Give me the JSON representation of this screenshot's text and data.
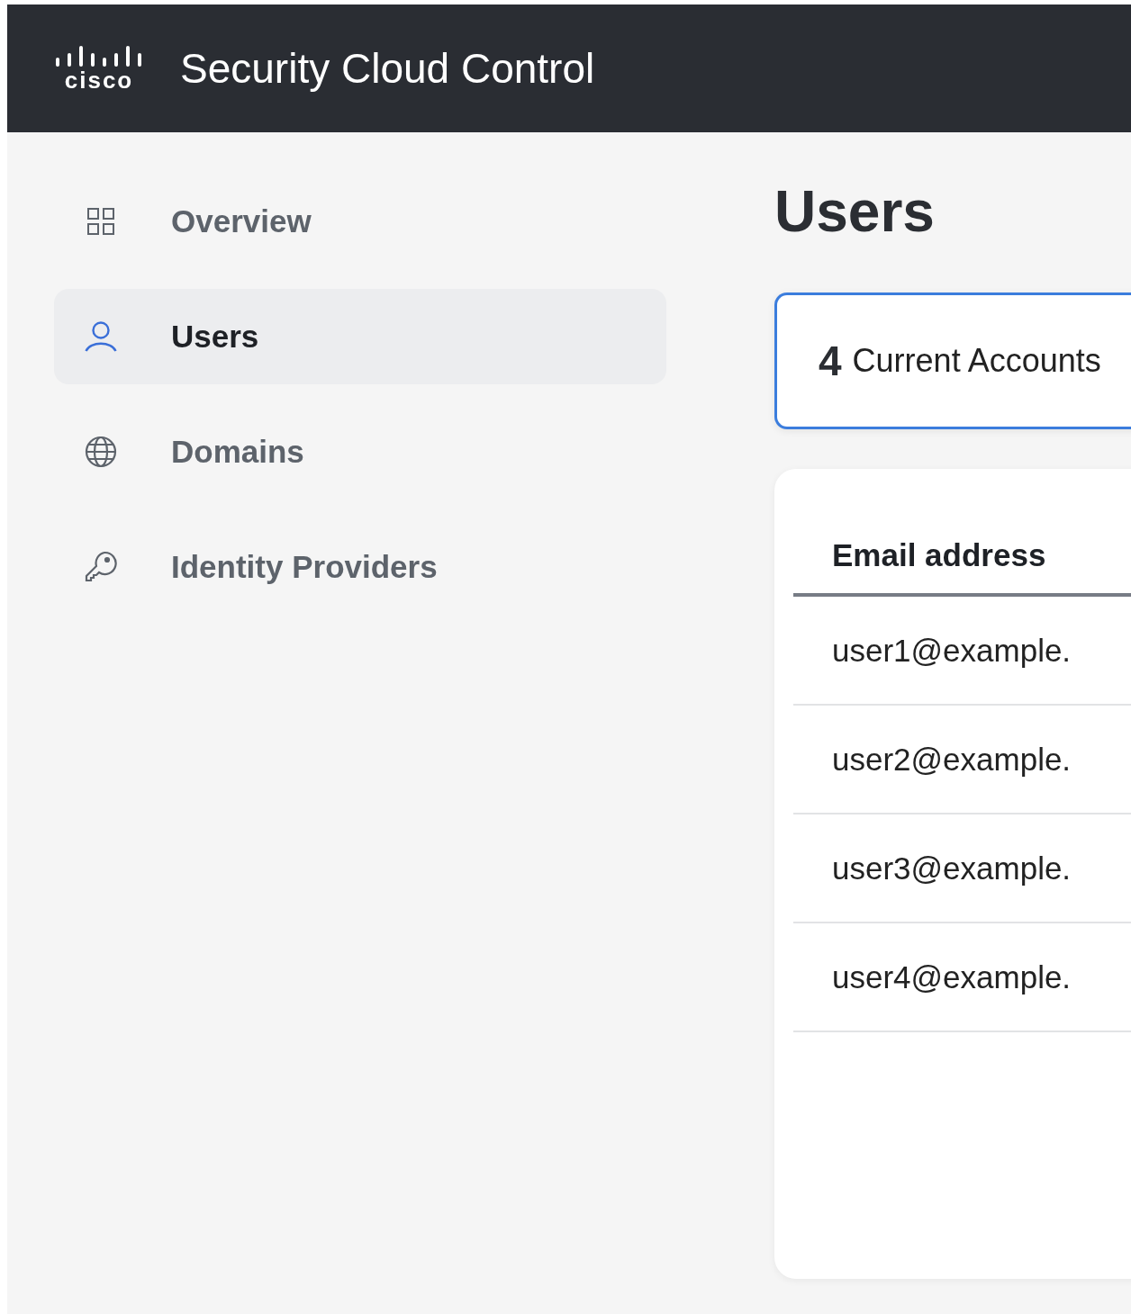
{
  "header": {
    "logo_text": "cisco",
    "title": "Security Cloud Control"
  },
  "sidebar": {
    "items": [
      {
        "label": "Overview",
        "kind": "overview",
        "selected": false
      },
      {
        "label": "Users",
        "kind": "users",
        "selected": true
      },
      {
        "label": "Domains",
        "kind": "domains",
        "selected": false
      },
      {
        "label": "Identity Providers",
        "kind": "providers",
        "selected": false
      }
    ]
  },
  "main": {
    "title": "Users",
    "summary": {
      "count": "4",
      "label": "Current Accounts"
    },
    "table": {
      "columns": [
        "Email address"
      ],
      "rows": [
        [
          "user1@example."
        ],
        [
          "user2@example."
        ],
        [
          "user3@example."
        ],
        [
          "user4@example."
        ]
      ]
    }
  }
}
